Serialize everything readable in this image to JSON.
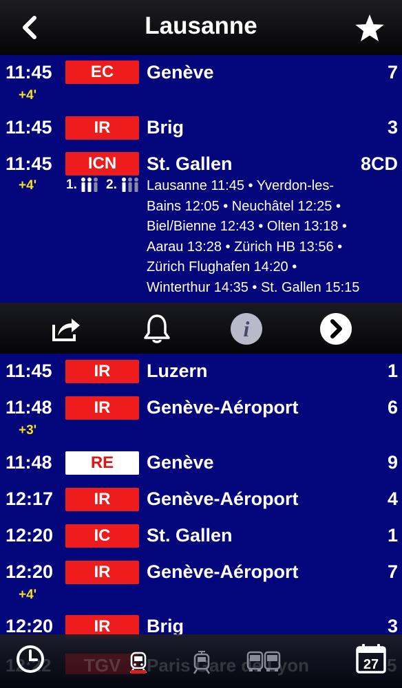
{
  "header": {
    "title": "Lausanne",
    "back_icon": "back-chevron-icon",
    "favorite_icon": "star-icon"
  },
  "departures": [
    {
      "time": "11:45",
      "delay": "+4'",
      "category": "EC",
      "destination": "Genève",
      "platform": "7"
    },
    {
      "time": "11:45",
      "delay": "",
      "category": "IR",
      "destination": "Brig",
      "platform": "3"
    },
    {
      "time": "11:45",
      "delay": "+4'",
      "category": "ICN",
      "destination": "St. Gallen",
      "platform": "8CD"
    },
    {
      "time": "11:45",
      "delay": "",
      "category": "IR",
      "destination": "Luzern",
      "platform": "1"
    },
    {
      "time": "11:48",
      "delay": "+3'",
      "category": "IR",
      "destination": "Genève-Aéroport",
      "platform": "6"
    },
    {
      "time": "11:48",
      "delay": "",
      "category": "RE",
      "destination": "Genève",
      "platform": "9"
    },
    {
      "time": "12:17",
      "delay": "",
      "category": "IR",
      "destination": "Genève-Aéroport",
      "platform": "4"
    },
    {
      "time": "12:20",
      "delay": "",
      "category": "IC",
      "destination": "St. Gallen",
      "platform": "1"
    },
    {
      "time": "12:20",
      "delay": "+4'",
      "category": "IR",
      "destination": "Genève-Aéroport",
      "platform": "7"
    },
    {
      "time": "12:20",
      "delay": "",
      "category": "IR",
      "destination": "Brig",
      "platform": "3"
    },
    {
      "time": "12:22",
      "delay": "",
      "category": "TGV",
      "destination": "Paris Gare de Lyon",
      "platform": "5"
    }
  ],
  "expanded": {
    "class_first": "1.",
    "class_second": "2.",
    "stops": [
      "Lausanne 11:45 • Yverdon-les-",
      "Bains 12:05 • Neuchâtel 12:25 •",
      "Biel/Bienne 12:43 • Olten 13:18 •",
      "Aarau 13:28 • Zürich HB 13:56 •",
      "Zürich Flughafen 14:20 •",
      "Winterthur 14:35 • St. Gallen 15:15"
    ]
  },
  "actions": [
    "share-icon",
    "bell-icon",
    "info-icon",
    "next-arrow-icon"
  ],
  "tabbar": {
    "calendar_day": "27",
    "tabs": [
      "clock-icon",
      "train-icon",
      "tram-icon",
      "bus-icon",
      "calendar-icon"
    ]
  },
  "colors": {
    "background": "#02067a",
    "badge_red": "#ee1c1c",
    "delay_yellow": "#f6e21d"
  }
}
